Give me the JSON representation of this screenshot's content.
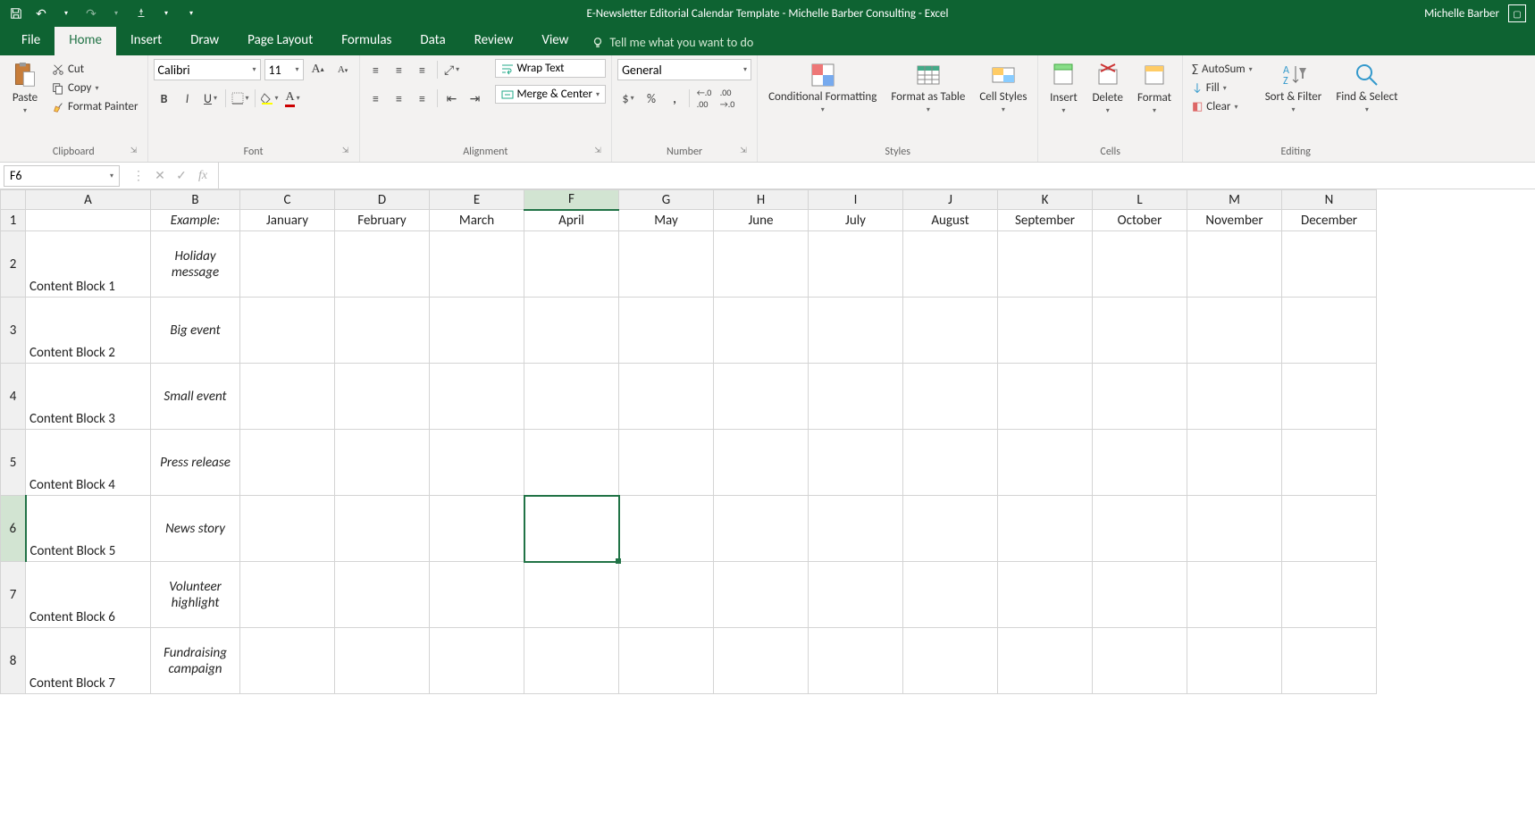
{
  "titlebar": {
    "title": "E-Newsletter Editorial Calendar Template - Michelle Barber Consulting - Excel",
    "user": "Michelle Barber"
  },
  "tabs": [
    "File",
    "Home",
    "Insert",
    "Draw",
    "Page Layout",
    "Formulas",
    "Data",
    "Review",
    "View"
  ],
  "active_tab": 1,
  "tellme": "Tell me what you want to do",
  "ribbon": {
    "clipboard": {
      "paste": "Paste",
      "cut": "Cut",
      "copy": "Copy",
      "painter": "Format Painter",
      "label": "Clipboard"
    },
    "font": {
      "name": "Calibri",
      "size": "11",
      "bold": "B",
      "italic": "I",
      "underline": "U",
      "label": "Font"
    },
    "alignment": {
      "wrap": "Wrap Text",
      "merge": "Merge & Center",
      "label": "Alignment"
    },
    "number": {
      "format": "General",
      "label": "Number"
    },
    "styles": {
      "cond": "Conditional Formatting",
      "fmtas": "Format as Table",
      "cellst": "Cell Styles",
      "label": "Styles"
    },
    "cells": {
      "insert": "Insert",
      "delete": "Delete",
      "format": "Format",
      "label": "Cells"
    },
    "editing": {
      "autosum": "AutoSum",
      "fill": "Fill",
      "clear": "Clear",
      "sort": "Sort & Filter",
      "find": "Find & Select",
      "label": "Editing"
    }
  },
  "formula_bar": {
    "cell_ref": "F6",
    "formula": ""
  },
  "grid": {
    "columns": [
      "A",
      "B",
      "C",
      "D",
      "E",
      "F",
      "G",
      "H",
      "I",
      "J",
      "K",
      "L",
      "M",
      "N"
    ],
    "selected_col": "F",
    "selected_row": 6,
    "row1": {
      "B": "Example:",
      "C": "January",
      "D": "February",
      "E": "March",
      "F": "April",
      "G": "May",
      "H": "June",
      "I": "July",
      "J": "August",
      "K": "September",
      "L": "October",
      "M": "November",
      "N": "December"
    },
    "blocks": [
      {
        "A": "Content Block 1",
        "B": "Holiday message"
      },
      {
        "A": "Content Block 2",
        "B": "Big event"
      },
      {
        "A": "Content Block 3",
        "B": "Small event"
      },
      {
        "A": "Content Block 4",
        "B": "Press release"
      },
      {
        "A": "Content Block 5",
        "B": "News story"
      },
      {
        "A": "Content Block 6",
        "B": "Volunteer highlight"
      },
      {
        "A": "Content Block 7",
        "B": "Fundraising campaign"
      }
    ]
  }
}
